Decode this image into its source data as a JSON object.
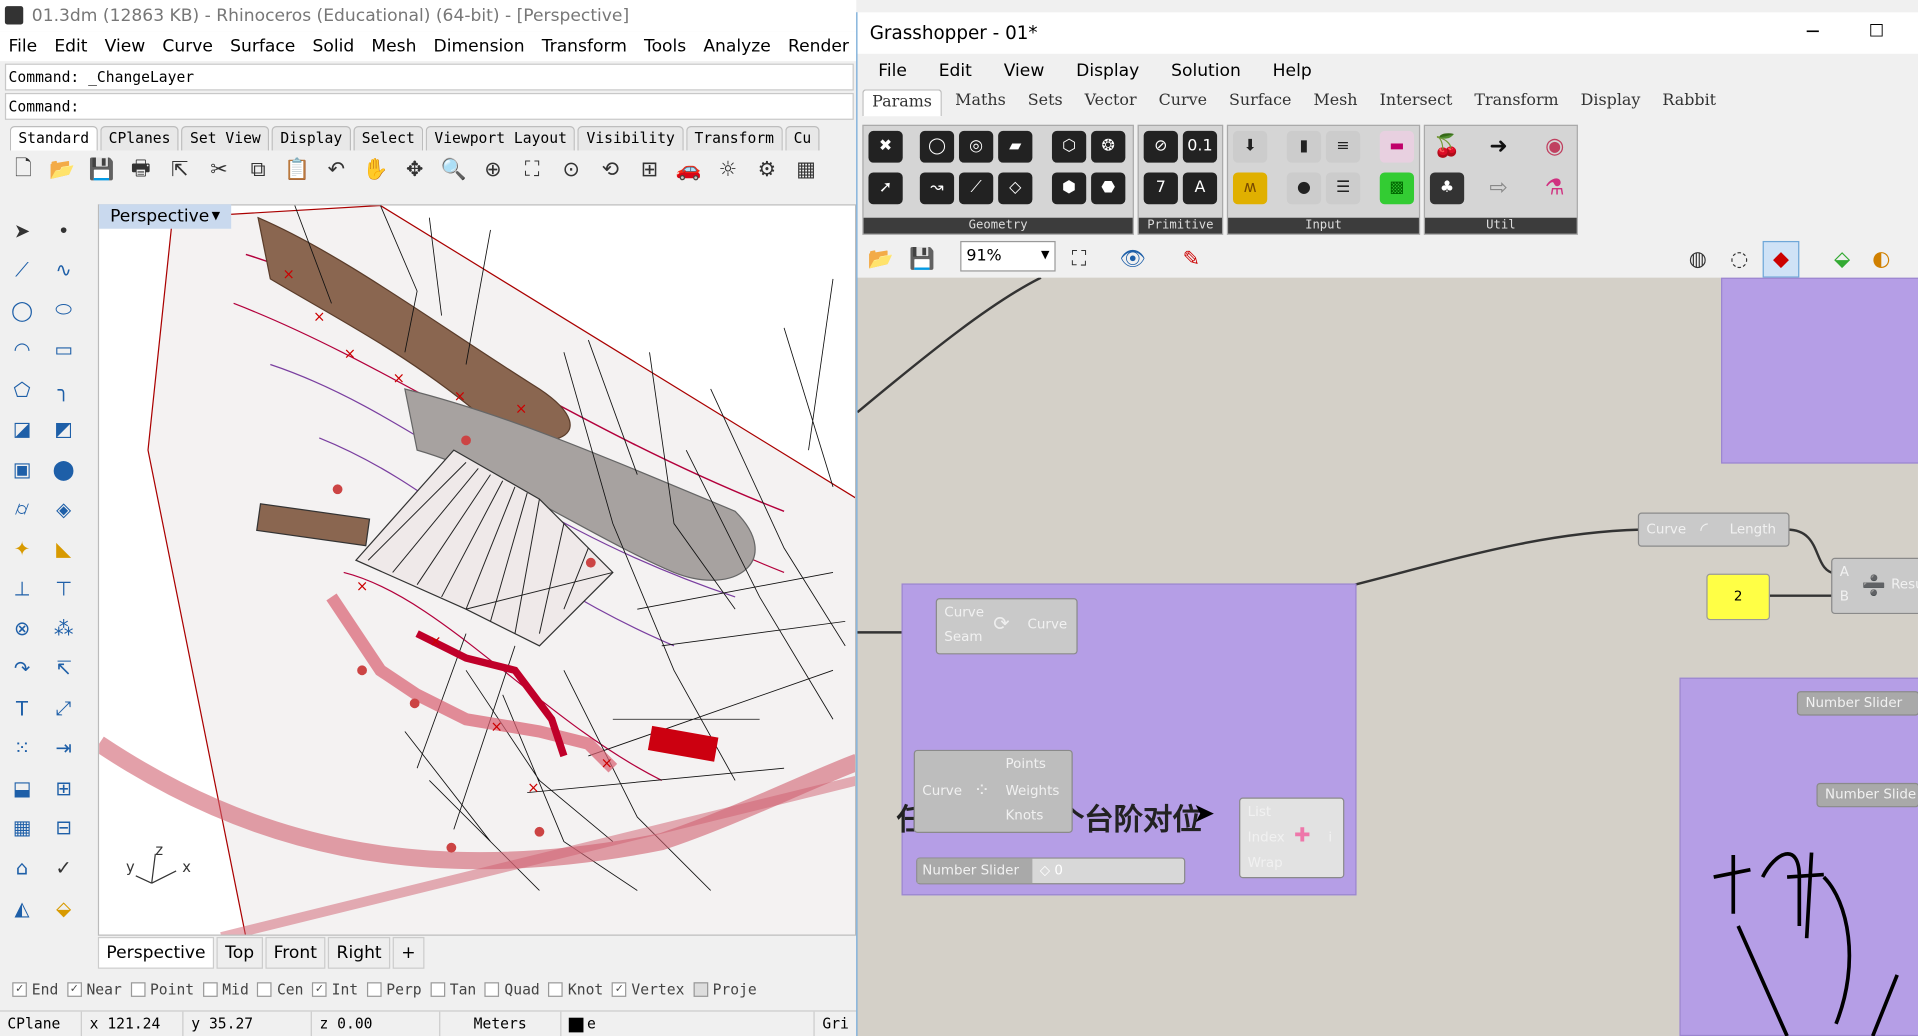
{
  "rhino": {
    "title": "01.3dm (12863 KB) - Rhinoceros (Educational) (64-bit) - [Perspective]",
    "menu": [
      "File",
      "Edit",
      "View",
      "Curve",
      "Surface",
      "Solid",
      "Mesh",
      "Dimension",
      "Transform",
      "Tools",
      "Analyze",
      "Render"
    ],
    "command_history": "Command: _ChangeLayer",
    "command_prompt": "Command:",
    "toolbar_tabs": [
      "Standard",
      "CPlanes",
      "Set View",
      "Display",
      "Select",
      "Viewport Layout",
      "Visibility",
      "Transform",
      "Cu"
    ],
    "viewport_label": "Perspective",
    "viewport_tabs": [
      "Perspective",
      "Top",
      "Front",
      "Right",
      "+"
    ],
    "axis": {
      "x": "x",
      "y": "y",
      "z": "z"
    },
    "osnaps": [
      {
        "label": "End",
        "checked": true
      },
      {
        "label": "Near",
        "checked": true
      },
      {
        "label": "Point",
        "checked": false
      },
      {
        "label": "Mid",
        "checked": false
      },
      {
        "label": "Cen",
        "checked": false
      },
      {
        "label": "Int",
        "checked": true
      },
      {
        "label": "Perp",
        "checked": false
      },
      {
        "label": "Tan",
        "checked": false
      },
      {
        "label": "Quad",
        "checked": false
      },
      {
        "label": "Knot",
        "checked": false
      },
      {
        "label": "Vertex",
        "checked": true
      },
      {
        "label": "Proje",
        "checked": false
      }
    ],
    "status": {
      "cplane": "CPlane",
      "x": "x 121.24",
      "y": "y 35.27",
      "z": "z 0.00",
      "units": "Meters",
      "layer": "e",
      "grid": "Gri"
    }
  },
  "grasshopper": {
    "title": "Grasshopper - 01*",
    "minimize": "─",
    "maximize": "☐",
    "menu": [
      "File",
      "Edit",
      "View",
      "Display",
      "Solution",
      "Help"
    ],
    "tabs": [
      "Params",
      "Maths",
      "Sets",
      "Vector",
      "Curve",
      "Surface",
      "Mesh",
      "Intersect",
      "Transform",
      "Display",
      "Rabbit"
    ],
    "panels": [
      {
        "label": "Geometry"
      },
      {
        "label": "Primitive"
      },
      {
        "label": "Input"
      },
      {
        "label": "Util"
      }
    ],
    "zoom": "91%",
    "group_title": "任务4：第2个台阶对位",
    "components": {
      "seam": {
        "in1": "Curve",
        "in2": "Seam",
        "out": "Curve"
      },
      "ctrl": {
        "in": "Curve",
        "out1": "Points",
        "out2": "Weights",
        "out3": "Knots"
      },
      "slider_small": {
        "label": "Number Slider",
        "value": "◇ 0"
      },
      "list": {
        "in1": "List",
        "in2": "Index",
        "in3": "Wrap",
        "out": "i"
      },
      "length": {
        "in": "Curve",
        "out": "Length"
      },
      "panel_value": "2",
      "div": {
        "a": "A",
        "b": "B",
        "out": "Resu"
      },
      "slider_a": "Number Slider",
      "slider_b": "Number Slide"
    }
  }
}
